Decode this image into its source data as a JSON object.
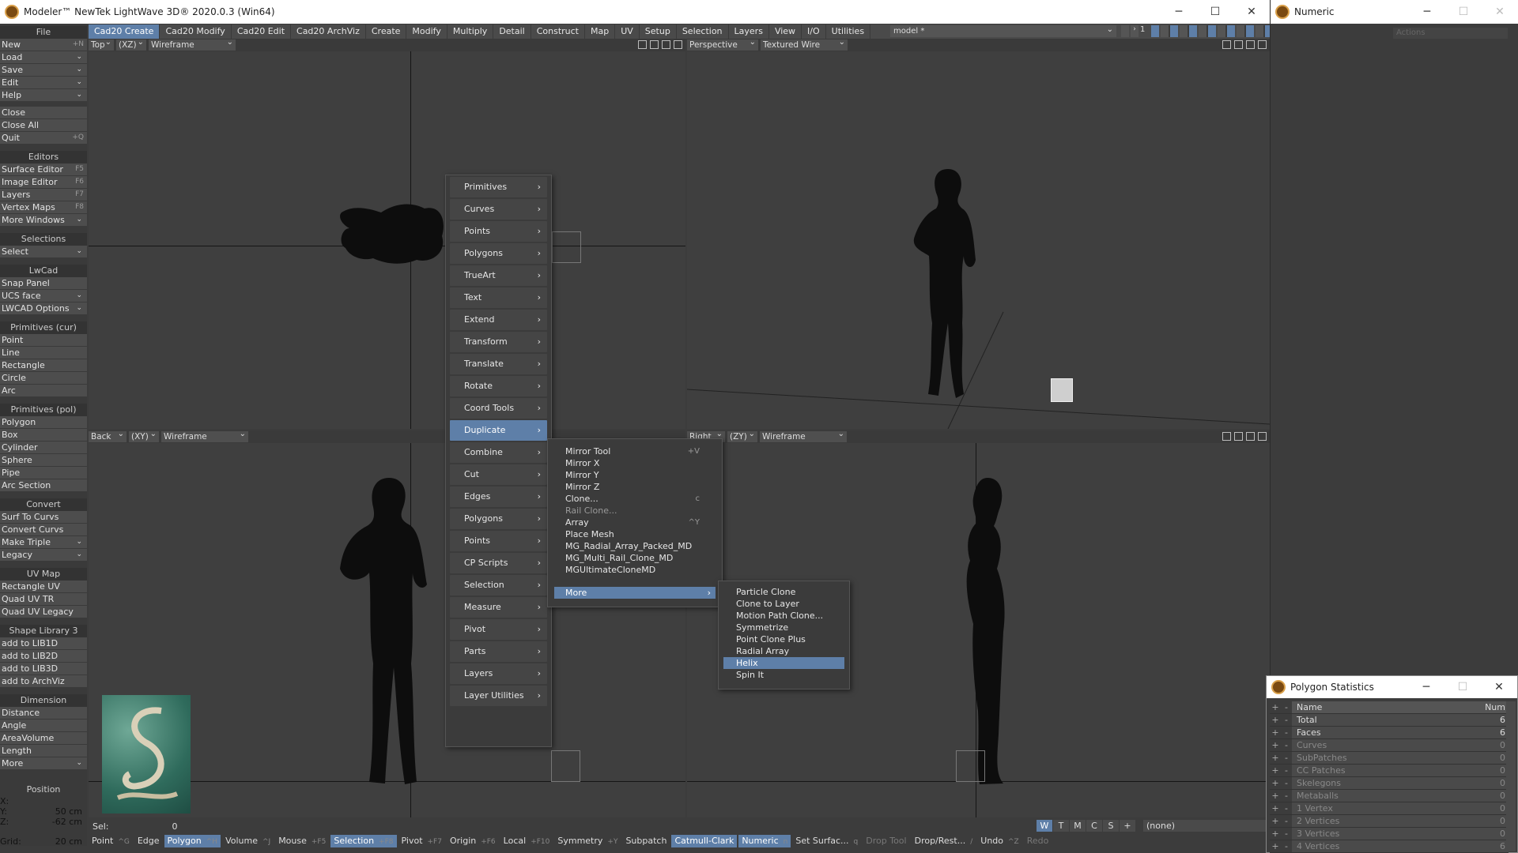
{
  "app": {
    "title": "Modeler™ NewTek LightWave 3D® 2020.0.3 (Win64)",
    "model": "model *",
    "layer_num": "1"
  },
  "tabs": [
    "Cad20 Create",
    "Cad20 Modify",
    "Cad20 Edit",
    "Cad20 ArchViz",
    "Create",
    "Modify",
    "Multiply",
    "Detail",
    "Construct",
    "Map",
    "UV",
    "Setup",
    "Selection",
    "Layers",
    "View",
    "I/O",
    "Utilities"
  ],
  "sidebar": {
    "file": {
      "head": "File",
      "items": [
        {
          "l": "New",
          "s": "+N"
        },
        {
          "l": "Load",
          "dd": "⌄"
        },
        {
          "l": "Save",
          "dd": "⌄"
        },
        {
          "l": "Edit",
          "dd": "⌄"
        },
        {
          "l": "Help",
          "dd": "⌄"
        }
      ]
    },
    "file2": [
      {
        "l": "Close",
        "s": ""
      },
      {
        "l": "Close All",
        "s": ""
      },
      {
        "l": "Quit",
        "s": "+Q"
      }
    ],
    "editors": {
      "head": "Editors",
      "items": [
        {
          "l": "Surface Editor",
          "s": "F5"
        },
        {
          "l": "Image Editor",
          "s": "F6"
        },
        {
          "l": "Layers",
          "s": "F7"
        },
        {
          "l": "Vertex Maps",
          "s": "F8"
        },
        {
          "l": "More Windows",
          "dd": "⌄"
        }
      ]
    },
    "selections": {
      "head": "Selections",
      "items": [
        {
          "l": "Select",
          "dd": "⌄"
        }
      ]
    },
    "lwcad": {
      "head": "LwCad",
      "items": [
        {
          "l": "Snap Panel"
        },
        {
          "l": "UCS face",
          "dd": "⌄"
        },
        {
          "l": "LWCAD Options",
          "dd": "⌄"
        }
      ]
    },
    "primcur": {
      "head": "Primitives (cur)",
      "items": [
        {
          "l": "Point"
        },
        {
          "l": "Line"
        },
        {
          "l": "Rectangle"
        },
        {
          "l": "Circle"
        },
        {
          "l": "Arc"
        }
      ]
    },
    "primpol": {
      "head": "Primitives (pol)",
      "items": [
        {
          "l": "Polygon"
        },
        {
          "l": "Box"
        },
        {
          "l": "Cylinder"
        },
        {
          "l": "Sphere"
        },
        {
          "l": "Pipe"
        },
        {
          "l": "Arc Section"
        }
      ]
    },
    "convert": {
      "head": "Convert",
      "items": [
        {
          "l": "Surf To Curvs"
        },
        {
          "l": "Convert Curvs"
        },
        {
          "l": "Make Triple",
          "dd": "⌄"
        },
        {
          "l": "Legacy",
          "dd": "⌄"
        }
      ]
    },
    "uvmap": {
      "head": "UV Map",
      "items": [
        {
          "l": "Rectangle UV"
        },
        {
          "l": "Quad UV TR"
        },
        {
          "l": "Quad UV Legacy"
        }
      ]
    },
    "shapelib": {
      "head": "Shape Library 3",
      "items": [
        {
          "l": "add to LIB1D"
        },
        {
          "l": "add to LIB2D"
        },
        {
          "l": "add to LIB3D"
        },
        {
          "l": "add to ArchViz"
        }
      ]
    },
    "dimension": {
      "head": "Dimension",
      "items": [
        {
          "l": "Distance"
        },
        {
          "l": "Angle"
        },
        {
          "l": "AreaVolume"
        },
        {
          "l": "Length"
        },
        {
          "l": "More",
          "dd": "⌄"
        }
      ]
    }
  },
  "position": {
    "head": "Position",
    "x_label": "X:",
    "y_label": "Y:",
    "y": "50 cm",
    "z_label": "Z:",
    "z": "-62 cm",
    "grid_label": "Grid:",
    "grid": "20 cm"
  },
  "viewports": {
    "tl": {
      "view": "Top",
      "axis": "(XZ)",
      "mode": "Wireframe"
    },
    "tr": {
      "view": "Perspective",
      "mode": "Textured Wire"
    },
    "bl": {
      "view": "Back",
      "axis": "(XY)",
      "mode": "Wireframe"
    },
    "br": {
      "view": "Right",
      "axis": "(ZY)",
      "mode": "Wireframe"
    }
  },
  "popup_menu": [
    "Primitives",
    "Curves",
    "Points",
    "Polygons",
    "TrueArt",
    "Text",
    "Extend",
    "Transform",
    "Translate",
    "Rotate",
    "Coord Tools",
    "Duplicate",
    "Combine",
    "Cut",
    "Edges",
    "Polygons",
    "Points",
    "CP Scripts",
    "Selection",
    "Measure",
    "Pivot",
    "Parts",
    "Layers",
    "Layer Utilities"
  ],
  "duplicate_menu": [
    {
      "l": "Mirror Tool",
      "s": "+V"
    },
    {
      "l": "Mirror X"
    },
    {
      "l": "Mirror Y"
    },
    {
      "l": "Mirror Z"
    },
    {
      "l": "Clone...",
      "s": "c"
    },
    {
      "l": "Rail Clone...",
      "dim": true
    },
    {
      "l": "Array",
      "s": "^Y"
    },
    {
      "l": "Place Mesh"
    },
    {
      "l": "MG_Radial_Array_Packed_MD"
    },
    {
      "l": "MG_Multi_Rail_Clone_MD"
    },
    {
      "l": "MGUltimateCloneMD"
    }
  ],
  "duplicate_more": "More",
  "more_menu": [
    "Particle Clone",
    "Clone to Layer",
    "Motion Path Clone...",
    "Symmetrize",
    "Point Clone Plus",
    "Radial Array",
    "Helix",
    "Spin It"
  ],
  "selrow": {
    "label": "Sel:",
    "value": "0"
  },
  "wtmcs": [
    "W",
    "T",
    "M",
    "C",
    "S",
    "+"
  ],
  "none_sel": "(none)",
  "statusbar": [
    {
      "l": "Point",
      "s": "^G"
    },
    {
      "l": "Edge",
      "s": ""
    },
    {
      "l": "Polygon",
      "s": "^H",
      "hl": true
    },
    {
      "l": "Volume",
      "s": "^J"
    },
    {
      "l": "Mouse",
      "s": "+F5"
    },
    {
      "l": "Selection",
      "s": "+F8",
      "hl": true
    },
    {
      "l": "Pivot",
      "s": "+F7"
    },
    {
      "l": "Origin",
      "s": "+F6"
    },
    {
      "l": "Local",
      "s": "+F10"
    },
    {
      "l": "Symmetry",
      "s": "+Y"
    },
    {
      "l": "Subpatch",
      "s": ""
    },
    {
      "l": "Catmull-Clark",
      "s": "",
      "hl": true
    },
    {
      "l": "Numeric",
      "s": "n",
      "hl": true
    },
    {
      "l": "Set Surfac...",
      "s": "q"
    },
    {
      "l": "Drop Tool",
      "s": "",
      "dim": true
    },
    {
      "l": "Drop/Rest...",
      "s": "/"
    },
    {
      "l": "Undo",
      "s": "^Z"
    },
    {
      "l": "Redo",
      "s": "",
      "dim": true
    }
  ],
  "numeric": {
    "title": "Numeric",
    "actions": "Actions"
  },
  "polystats": {
    "title": "Polygon Statistics",
    "cols": [
      "Name",
      "Num"
    ],
    "rows": [
      {
        "n": "Total",
        "v": "6"
      },
      {
        "n": "Faces",
        "v": "6"
      },
      {
        "n": "Curves",
        "v": "0",
        "dim": true
      },
      {
        "n": "SubPatches",
        "v": "0",
        "dim": true
      },
      {
        "n": "CC Patches",
        "v": "0",
        "dim": true
      },
      {
        "n": "Skelegons",
        "v": "0",
        "dim": true
      },
      {
        "n": "Metaballs",
        "v": "0",
        "dim": true
      },
      {
        "n": "1 Vertex",
        "v": "0",
        "dim": true
      },
      {
        "n": "2 Vertices",
        "v": "0",
        "dim": true
      },
      {
        "n": "3 Vertices",
        "v": "0",
        "dim": true
      },
      {
        "n": "4 Vertices",
        "v": "6",
        "dim": true
      }
    ]
  }
}
